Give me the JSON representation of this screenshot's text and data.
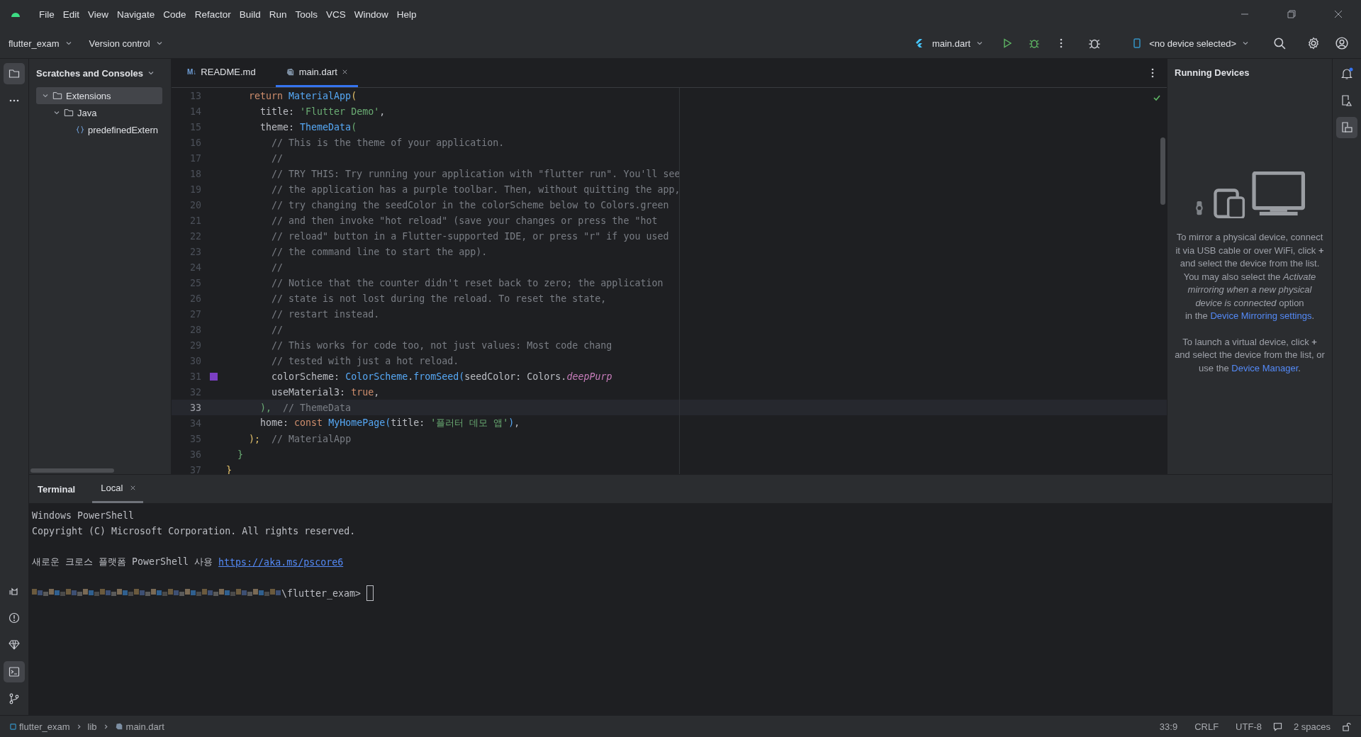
{
  "menu": [
    "File",
    "Edit",
    "View",
    "Navigate",
    "Code",
    "Refactor",
    "Build",
    "Run",
    "Tools",
    "VCS",
    "Window",
    "Help"
  ],
  "toolbar": {
    "project": "flutter_exam",
    "vcs": "Version control",
    "run_config": "main.dart",
    "device": "<no device selected>"
  },
  "left_stripe": [
    {
      "kind": "folder",
      "selected": true
    },
    {
      "kind": "more",
      "selected": false
    }
  ],
  "left_stripe_bottom": [
    {
      "kind": "cat",
      "selected": false
    },
    {
      "kind": "problems",
      "selected": false
    },
    {
      "kind": "gem",
      "selected": false
    },
    {
      "kind": "terminal",
      "selected": true
    },
    {
      "kind": "branch",
      "selected": false
    }
  ],
  "project_panel": {
    "title": "Scratches and Consoles",
    "tree": [
      {
        "label": "Extensions",
        "kind": "folder",
        "expanded": true,
        "selected": true,
        "children": [
          {
            "label": "Java",
            "kind": "folder",
            "expanded": true,
            "selected": false,
            "children": [
              {
                "label": "predefinedExtern",
                "kind": "file",
                "selected": false
              }
            ]
          }
        ]
      }
    ]
  },
  "editor_tabs": [
    {
      "icon": "M↓",
      "kind": "markdown",
      "label": "README.md",
      "selected": false,
      "closable": false
    },
    {
      "kind": "dart",
      "label": "main.dart",
      "selected": true,
      "closable": true
    }
  ],
  "code": [
    {
      "num": "13",
      "current": false,
      "tokens": [
        {
          "kind": "keyword",
          "t": "    return "
        },
        {
          "kind": "type",
          "t": "MaterialApp"
        },
        {
          "kind": "paren_y",
          "t": "("
        }
      ]
    },
    {
      "num": "14",
      "current": false,
      "tokens": [
        {
          "kind": "plain",
          "t": "      title: "
        },
        {
          "kind": "string",
          "t": "'Flutter Demo'"
        },
        {
          "kind": "plain",
          "t": ","
        }
      ]
    },
    {
      "num": "15",
      "current": false,
      "tokens": [
        {
          "kind": "plain",
          "t": "      theme: "
        },
        {
          "kind": "type",
          "t": "ThemeData"
        },
        {
          "kind": "paren_g",
          "t": "("
        }
      ]
    },
    {
      "num": "16",
      "current": false,
      "tokens": [
        {
          "kind": "comment",
          "t": "        // This is the theme of your application."
        }
      ]
    },
    {
      "num": "17",
      "current": false,
      "tokens": [
        {
          "kind": "comment",
          "t": "        //"
        }
      ]
    },
    {
      "num": "18",
      "current": false,
      "tokens": [
        {
          "kind": "comment",
          "t": "        // TRY THIS: Try running your application with \"flutter run\". You'll see"
        }
      ]
    },
    {
      "num": "19",
      "current": false,
      "tokens": [
        {
          "kind": "comment",
          "t": "        // the application has a purple toolbar. Then, without quitting the app,"
        }
      ]
    },
    {
      "num": "20",
      "current": false,
      "tokens": [
        {
          "kind": "comment",
          "t": "        // try changing the seedColor in the colorScheme below to Colors.green"
        }
      ]
    },
    {
      "num": "21",
      "current": false,
      "tokens": [
        {
          "kind": "comment",
          "t": "        // and then invoke \"hot reload\" (save your changes or press the \"hot"
        }
      ]
    },
    {
      "num": "22",
      "current": false,
      "tokens": [
        {
          "kind": "comment",
          "t": "        // reload\" button in a Flutter-supported IDE, or press \"r\" if you used"
        }
      ]
    },
    {
      "num": "23",
      "current": false,
      "tokens": [
        {
          "kind": "comment",
          "t": "        // the command line to start the app)."
        }
      ]
    },
    {
      "num": "24",
      "current": false,
      "tokens": [
        {
          "kind": "comment",
          "t": "        //"
        }
      ]
    },
    {
      "num": "25",
      "current": false,
      "tokens": [
        {
          "kind": "comment",
          "t": "        // Notice that the counter didn't reset back to zero; the application"
        }
      ]
    },
    {
      "num": "26",
      "current": false,
      "tokens": [
        {
          "kind": "comment",
          "t": "        // state is not lost during the reload. To reset the state,"
        }
      ]
    },
    {
      "num": "27",
      "current": false,
      "tokens": [
        {
          "kind": "comment",
          "t": "        // restart instead."
        }
      ]
    },
    {
      "num": "28",
      "current": false,
      "tokens": [
        {
          "kind": "comment",
          "t": "        //"
        }
      ]
    },
    {
      "num": "29",
      "current": false,
      "tokens": [
        {
          "kind": "comment",
          "t": "        // This works for code too, not just values: Most code chang"
        }
      ]
    },
    {
      "num": "30",
      "current": false,
      "tokens": [
        {
          "kind": "comment",
          "t": "        // tested with just a hot reload."
        }
      ]
    },
    {
      "num": "31",
      "current": false,
      "color": "#7b3fc4",
      "tokens": [
        {
          "kind": "plain",
          "t": "        colorScheme: "
        },
        {
          "kind": "type",
          "t": "ColorScheme"
        },
        {
          "kind": "plain",
          "t": "."
        },
        {
          "kind": "method",
          "t": "fromSeed"
        },
        {
          "kind": "paren_b",
          "t": "("
        },
        {
          "kind": "plain",
          "t": "seedColor: Colors."
        },
        {
          "kind": "field",
          "t": "deepPurp"
        }
      ]
    },
    {
      "num": "32",
      "current": false,
      "tokens": [
        {
          "kind": "plain",
          "t": "        useMaterial3: "
        },
        {
          "kind": "keyword",
          "t": "true"
        },
        {
          "kind": "plain",
          "t": ","
        }
      ]
    },
    {
      "num": "33",
      "current": true,
      "tokens": [
        {
          "kind": "paren_g",
          "t": "      ),"
        },
        {
          "kind": "comment",
          "t": "  // ThemeData"
        }
      ]
    },
    {
      "num": "34",
      "current": false,
      "tokens": [
        {
          "kind": "plain",
          "t": "      home: "
        },
        {
          "kind": "keyword",
          "t": "const "
        },
        {
          "kind": "type",
          "t": "MyHomePage"
        },
        {
          "kind": "paren_b",
          "t": "("
        },
        {
          "kind": "plain",
          "t": "title: "
        },
        {
          "kind": "string",
          "t": "'플러터 데모 앱'"
        },
        {
          "kind": "paren_b",
          "t": ")"
        },
        {
          "kind": "plain",
          "t": ","
        }
      ]
    },
    {
      "num": "35",
      "current": false,
      "tokens": [
        {
          "kind": "paren_y",
          "t": "    );"
        },
        {
          "kind": "comment",
          "t": "  // MaterialApp"
        }
      ]
    },
    {
      "num": "36",
      "current": false,
      "tokens": [
        {
          "kind": "paren_g",
          "t": "  }"
        }
      ]
    },
    {
      "num": "37",
      "current": false,
      "tokens": [
        {
          "kind": "paren_y",
          "t": "}"
        }
      ]
    }
  ],
  "running_devices": {
    "title": "Running Devices",
    "mirror_text": "To mirror a physical device, connect it via USB cable or over WiFi, click **+** and select the device from the list. You may also select the *Activate mirroring when a new physical device is connected* option",
    "mirror_prefix": "in the",
    "mirror_link": "Device Mirroring settings",
    "mirror_suffix": ".",
    "virtual_text": "To launch a virtual device, click **+** and select the device from the list, or use the",
    "virtual_link": "Device Manager",
    "virtual_suffix": "."
  },
  "right_stripe": [
    {
      "kind": "bell",
      "selected": false,
      "badge": true
    },
    {
      "kind": "device",
      "selected": false,
      "badge": false
    },
    {
      "kind": "mirror",
      "selected": true,
      "badge": false
    }
  ],
  "terminal": {
    "title": "Terminal",
    "tabs": [
      {
        "label": "Local",
        "selected": true
      }
    ],
    "blocks": [
      [
        {
          "text": "Windows PowerShell"
        },
        {
          "text": "Copyright (C) Microsoft Corporation. All rights reserved."
        }
      ],
      [
        {
          "text": "새로운 크로스 플랫폼 PowerShell 사용",
          "link": "https://aka.ms/pscore6"
        }
      ]
    ],
    "prompt": {
      "redacted": true,
      "text": "\\flutter_exam>"
    }
  },
  "status_bar": {
    "breadcrumb": [
      {
        "label": "flutter_exam",
        "kind": "module"
      },
      {
        "label": "lib",
        "kind": "folder"
      },
      {
        "label": "main.dart",
        "kind": "dart"
      }
    ],
    "items": [
      "33:9",
      "CRLF",
      "UTF-8"
    ],
    "indent": "2 spaces"
  }
}
